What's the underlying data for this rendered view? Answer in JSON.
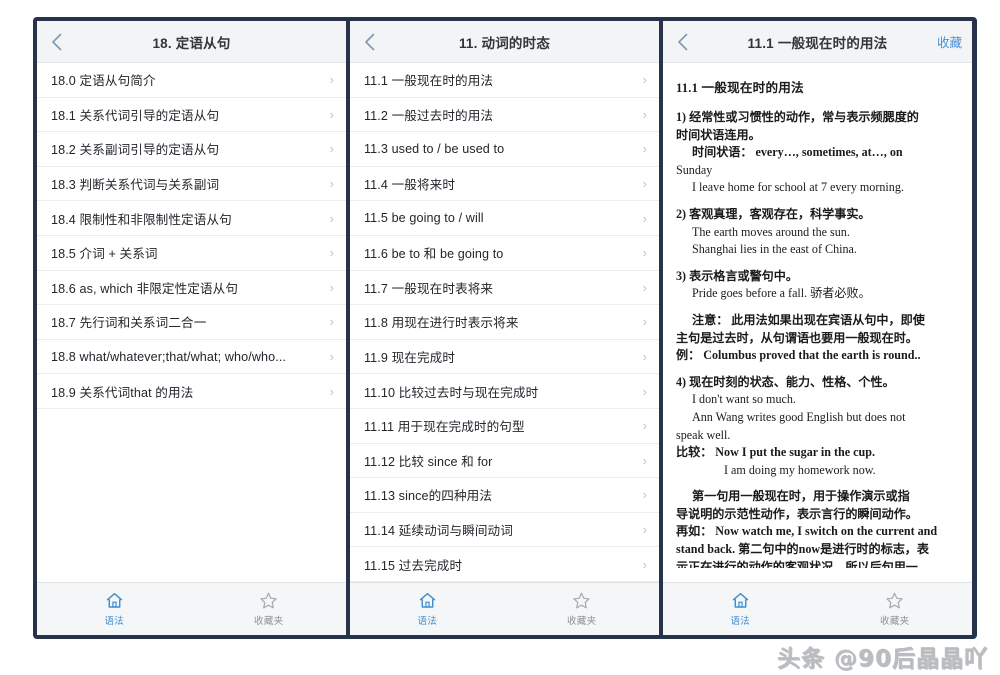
{
  "colors": {
    "frame": "#27334a",
    "header_bg": "#f3f4f6",
    "accent_blue": "#4a90d9",
    "tab_active": "#3f8ed0",
    "tab_inactive": "#8d9094",
    "chevron": "#c2c4c7"
  },
  "panels": [
    {
      "id": "panel-relative-clause",
      "header": {
        "back_icon": "chevron-left-icon",
        "title": "18. 定语从句",
        "action_label": ""
      },
      "items": [
        "18.0 定语从句简介",
        "18.1 关系代词引导的定语从句",
        "18.2 关系副词引导的定语从句",
        "18.3 判断关系代词与关系副词",
        "18.4 限制性和非限制性定语从句",
        "18.5 介词 + 关系词",
        "18.6 as, which 非限定性定语从句",
        "18.7 先行词和关系词二合一",
        "18.8 what/whatever;that/what; who/who...",
        "18.9 关系代词that 的用法"
      ],
      "tabbar": [
        {
          "icon": "home-icon",
          "label": "语法",
          "active": true
        },
        {
          "icon": "star-icon",
          "label": "收藏夹",
          "active": false
        }
      ]
    },
    {
      "id": "panel-verb-tense",
      "header": {
        "back_icon": "chevron-left-icon",
        "title": "11. 动词的时态",
        "action_label": ""
      },
      "items": [
        "11.1 一般现在时的用法",
        "11.2 一般过去时的用法",
        "11.3 used to / be used to",
        "11.4 一般将来时",
        "11.5 be going to / will",
        "11.6 be to 和 be going to",
        "11.7 一般现在时表将来",
        "11.8 用现在进行时表示将来",
        "11.9 现在完成时",
        "11.10 比较过去时与现在完成时",
        "11.11 用于现在完成时的句型",
        "11.12 比较 since 和 for",
        "11.13 since的四种用法",
        "11.14 延续动词与瞬间动词",
        "11.15 过去完成时"
      ],
      "tabbar": [
        {
          "icon": "home-icon",
          "label": "语法",
          "active": true
        },
        {
          "icon": "star-icon",
          "label": "收藏夹",
          "active": false
        }
      ]
    },
    {
      "id": "panel-article",
      "header": {
        "back_icon": "chevron-left-icon",
        "title": "11.1 一般现在时的用法",
        "action_label": "收藏"
      },
      "article": {
        "title": "11.1 一般现在时的用法",
        "blocks": [
          {
            "indent": 0,
            "cn": true,
            "text": "1) 经常性或习惯性的动作，常与表示频腮度的"
          },
          {
            "indent": 0,
            "cn": true,
            "text": "时间状语连用。"
          },
          {
            "indent": 1,
            "cn": true,
            "text": "时间状语： every…, sometimes,   at…, on"
          },
          {
            "indent": 0,
            "cn": false,
            "text": "Sunday"
          },
          {
            "indent": 1,
            "cn": false,
            "text": "I leave home for school at 7 every morning."
          },
          {
            "indent": 0,
            "cn": true,
            "text": "2) 客观真理，客观存在，科学事实。"
          },
          {
            "indent": 1,
            "cn": false,
            "text": "The earth moves around the sun."
          },
          {
            "indent": 1,
            "cn": false,
            "text": "Shanghai lies in the east of China."
          },
          {
            "indent": 0,
            "cn": true,
            "text": "3) 表示格言或警句中。"
          },
          {
            "indent": 1,
            "cn": false,
            "text": "Pride goes before a fall.   骄者必败。"
          },
          {
            "indent": 1,
            "cn": true,
            "text": "注意： 此用法如果出现在宾语从句中，即使"
          },
          {
            "indent": 0,
            "cn": true,
            "text": "主句是过去时，从句谓语也要用一般现在时。"
          },
          {
            "indent": 0,
            "cn": true,
            "text": "例： Columbus proved that the earth is round.."
          },
          {
            "indent": 0,
            "cn": true,
            "text": "4) 现在时刻的状态、能力、性格、个性。"
          },
          {
            "indent": 1,
            "cn": false,
            "text": "I don't want so much."
          },
          {
            "indent": 1,
            "cn": false,
            "text": "Ann Wang writes good English but does not"
          },
          {
            "indent": 0,
            "cn": false,
            "text": "speak well."
          },
          {
            "indent": 0,
            "cn": true,
            "text": "比较： Now I put the sugar in the cup."
          },
          {
            "indent": 2,
            "cn": false,
            "text": "I am doing my homework now."
          },
          {
            "indent": 1,
            "cn": true,
            "text": "第一句用一般现在时，用于操作演示或指"
          },
          {
            "indent": 0,
            "cn": true,
            "text": "导说明的示范性动作，表示言行的瞬间动作。"
          },
          {
            "indent": 0,
            "cn": true,
            "text": "再如： Now watch me, I switch on the current and"
          },
          {
            "indent": 0,
            "cn": true,
            "text": "stand back. 第二句中的now是进行时的标志，表"
          },
          {
            "indent": 0,
            "cn": true,
            "text": "示正在进行的动作的客观状况，所以后句用一"
          }
        ]
      },
      "tabbar": [
        {
          "icon": "home-icon",
          "label": "语法",
          "active": true
        },
        {
          "icon": "star-icon",
          "label": "收藏夹",
          "active": false
        }
      ]
    }
  ],
  "watermark": "头条 @90后晶晶吖"
}
